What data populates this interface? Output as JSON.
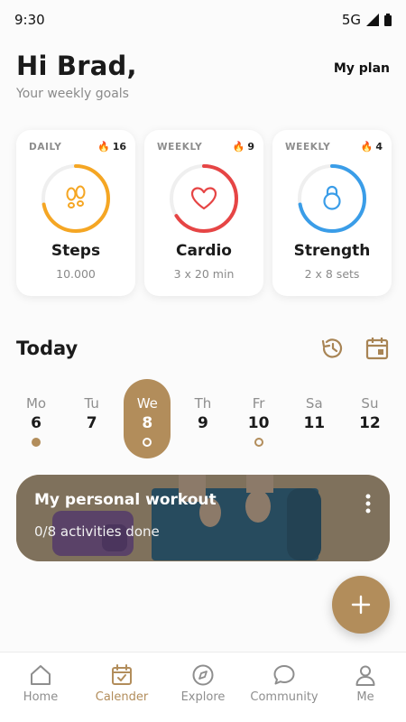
{
  "status_bar": {
    "time": "9:30",
    "network": "5G"
  },
  "header": {
    "greeting": "Hi Brad,",
    "subtitle": "Your weekly goals",
    "my_plan": "My plan"
  },
  "goals": [
    {
      "frequency": "DAILY",
      "streak": "16",
      "name": "Steps",
      "detail": "10.000",
      "color": "#f5a623",
      "icon": "footprints-icon",
      "progress": 0.72
    },
    {
      "frequency": "WEEKLY",
      "streak": "9",
      "name": "Cardio",
      "detail": "3 x 20 min",
      "color": "#e64545",
      "icon": "heart-icon",
      "progress": 0.66
    },
    {
      "frequency": "WEEKLY",
      "streak": "4",
      "name": "Strength",
      "detail": "2 x 8 sets",
      "color": "#3a9de8",
      "icon": "kettlebell-icon",
      "progress": 0.72
    }
  ],
  "today": {
    "title": "Today"
  },
  "week": [
    {
      "label": "Mo",
      "num": "6",
      "dot": "filled"
    },
    {
      "label": "Tu",
      "num": "7",
      "dot": "none"
    },
    {
      "label": "We",
      "num": "8",
      "dot": "ring",
      "active": true
    },
    {
      "label": "Th",
      "num": "9",
      "dot": "none"
    },
    {
      "label": "Fr",
      "num": "10",
      "dot": "ring"
    },
    {
      "label": "Sa",
      "num": "11",
      "dot": "none"
    },
    {
      "label": "Su",
      "num": "12",
      "dot": "none"
    }
  ],
  "workout": {
    "title": "My personal workout",
    "progress_text": "0/8 activities done"
  },
  "nav": [
    {
      "label": "Home",
      "icon": "home-icon"
    },
    {
      "label": "Calender",
      "icon": "calendar-check-icon",
      "active": true
    },
    {
      "label": "Explore",
      "icon": "compass-icon"
    },
    {
      "label": "Community",
      "icon": "chat-bubble-icon"
    },
    {
      "label": "Me",
      "icon": "person-icon"
    }
  ],
  "colors": {
    "accent": "#b28d5b",
    "steps": "#f5a623",
    "cardio": "#e64545",
    "strength": "#3a9de8"
  }
}
